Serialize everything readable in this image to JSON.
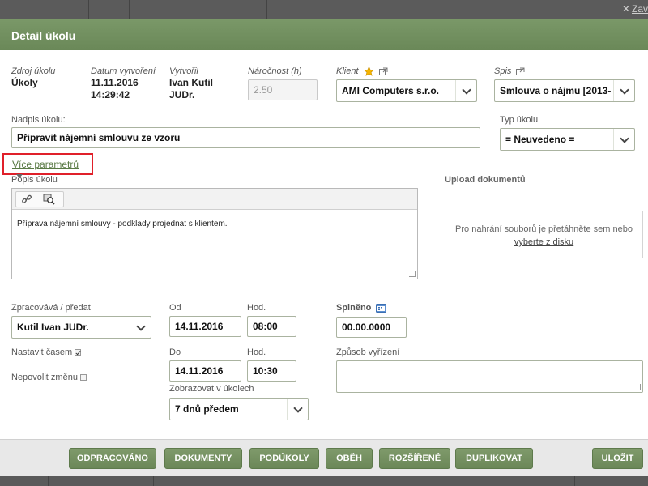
{
  "dialog": {
    "title": "Detail úkolu",
    "close_label": "Zav"
  },
  "info": {
    "source_label": "Zdroj úkolu",
    "source_value": "Úkoly",
    "created_label": "Datum vytvoření",
    "created_date": "11.11.2016",
    "created_time": "14:29:42",
    "author_label": "Vytvořil",
    "author_line1": "Ivan Kutil",
    "author_line2": "JUDr.",
    "effort_label": "Náročnost (h)",
    "effort_value": "2.50",
    "client_label": "Klient",
    "client_value": "AMI Computers s.r.o.",
    "file_label": "Spis",
    "file_value": "Smlouva o nájmu [2013-"
  },
  "task": {
    "title_label": "Nadpis úkolu:",
    "title_value": "Připravit nájemní smlouvu ze vzoru",
    "type_label": "Typ úkolu",
    "type_value": "= Neuvedeno ="
  },
  "more_params": {
    "label": "Více parametrů"
  },
  "description": {
    "label": "Popis úkolu",
    "text": "Příprava nájemní smlouvy - podklady projednat s klientem."
  },
  "upload": {
    "label": "Upload dokumentů",
    "hint": "Pro nahrání souborů je přetáhněte sem nebo",
    "link": "vyberte z disku"
  },
  "assign": {
    "assignee_label": "Zpracovává / předat",
    "assignee_value": "Kutil Ivan JUDr.",
    "time_label": "Nastavit časem",
    "lock_label": "Nepovolit změnu",
    "from_label": "Od",
    "from_date": "14.11.2016",
    "from_hour_label": "Hod.",
    "from_hour": "08:00",
    "to_label": "Do",
    "to_date": "14.11.2016",
    "to_hour_label": "Hod.",
    "to_hour": "10:30",
    "show_label": "Zobrazovat v úkolech",
    "show_value": "7 dnů předem",
    "done_label": "Splněno",
    "done_value": "00.00.0000",
    "resolution_label": "Způsob vyřízení"
  },
  "footer": {
    "buttons": [
      "ODPRACOVÁNO",
      "DOKUMENTY",
      "PODÚKOLY",
      "OBĚH",
      "ROZŠÍŘENÉ",
      "DUPLIKOVAT"
    ],
    "save": "ULOŽIT"
  },
  "colors": {
    "header": "#6f8d5d",
    "button": "#738f60",
    "highlight": "#e0202a",
    "link": "#5a7a45"
  }
}
